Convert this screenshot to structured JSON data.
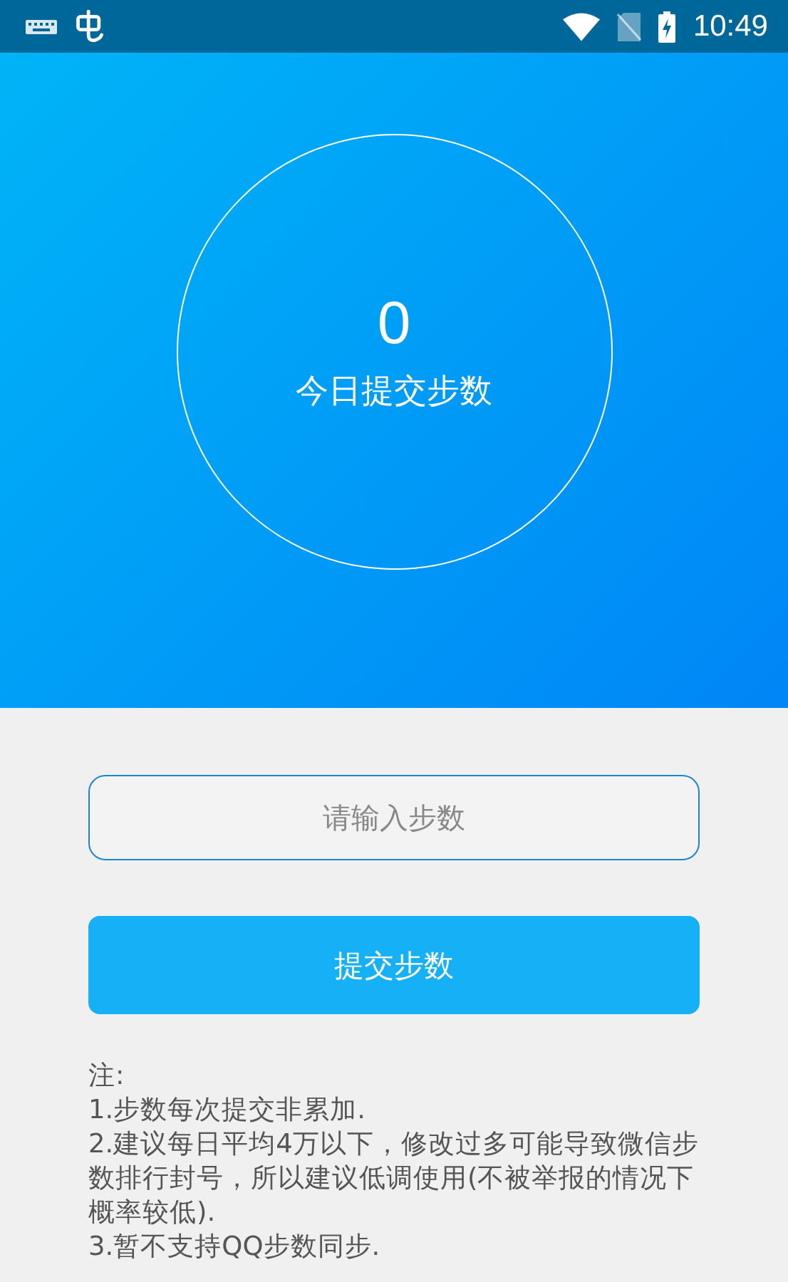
{
  "status_bar": {
    "time": "10:49"
  },
  "summary": {
    "count": "0",
    "label": "今日提交步数"
  },
  "step_input": {
    "placeholder": "请输入步数"
  },
  "submit_button": {
    "label": "提交步数"
  },
  "notes": {
    "title": "注:",
    "items": [
      "1.步数每次提交非累加.",
      "2.建议每日平均4万以下，修改过多可能导致微信步数排行封号，所以建议低调使用(不被举报的情况下概率较低).",
      "3.暂不支持QQ步数同步."
    ]
  }
}
